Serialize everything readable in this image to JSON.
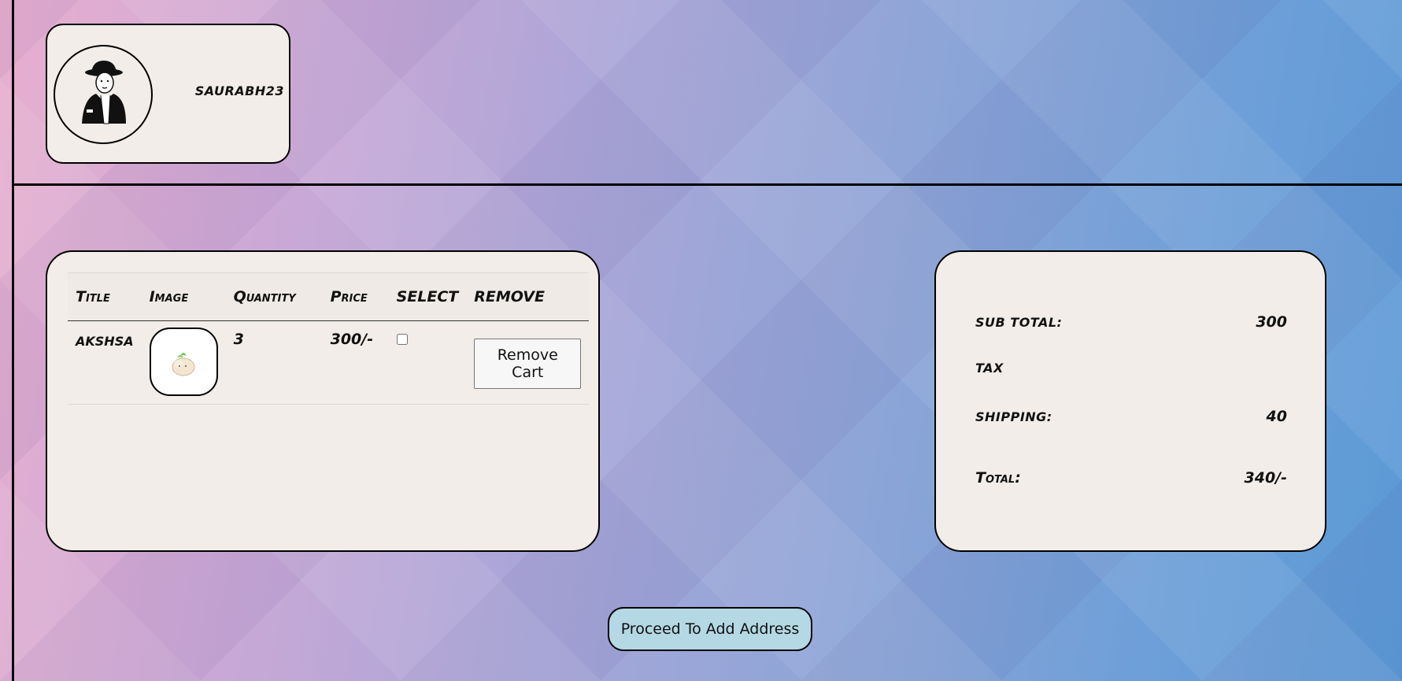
{
  "profile": {
    "username": "saurabh23",
    "avatar_icon": "user-avatar-icon"
  },
  "cart": {
    "columns": {
      "title": "Title",
      "image": "Image",
      "quantity": "Quantity",
      "price": "Price",
      "select": "SELECT",
      "remove": "REMOVE"
    },
    "items": [
      {
        "title": "AKSHSA",
        "image_icon": "product-image-icon",
        "quantity": "3",
        "price": "300/-",
        "selected": false,
        "remove_label": "Remove Cart"
      }
    ]
  },
  "summary": {
    "subtotal_label": "sub total:",
    "subtotal_value": "300",
    "tax_label": "tax",
    "tax_value": "",
    "shipping_label": "shipping:",
    "shipping_value": "40",
    "total_label": "Total:",
    "total_value": "340/-"
  },
  "actions": {
    "proceed_label": "Proceed To Add Address"
  },
  "colors": {
    "card_bg": "#f2ede8",
    "proceed_bg": "#b4d8e4",
    "bg_left": "#e8afcf",
    "bg_right": "#5a9ad6"
  }
}
